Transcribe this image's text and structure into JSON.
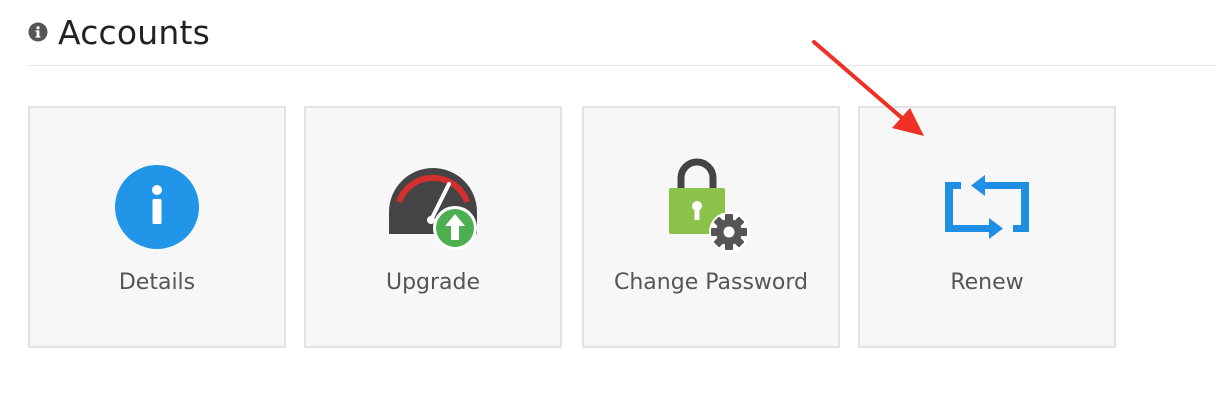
{
  "header": {
    "title": "Accounts",
    "icon": "info-circle-icon"
  },
  "tiles": [
    {
      "label": "Details",
      "icon": "info-icon",
      "color": "#2196e8"
    },
    {
      "label": "Upgrade",
      "icon": "speedometer-upgrade-icon",
      "color": "#4caf50"
    },
    {
      "label": "Change Password",
      "icon": "lock-gear-icon",
      "color": "#8bc34a"
    },
    {
      "label": "Renew",
      "icon": "renew-arrows-icon",
      "color": "#1f8fe6"
    }
  ],
  "annotation": {
    "type": "red-arrow",
    "target": "Renew",
    "color": "#ee3124"
  }
}
